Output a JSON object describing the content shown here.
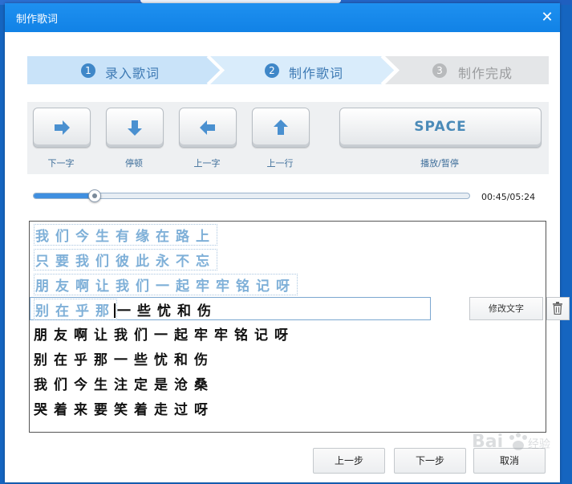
{
  "dialog": {
    "title": "制作歌词",
    "close_icon": "close-icon"
  },
  "steps": [
    {
      "num": "1",
      "label": "录入歌词",
      "state": "done"
    },
    {
      "num": "2",
      "label": "制作歌词",
      "state": "active"
    },
    {
      "num": "3",
      "label": "制作完成",
      "state": "pending"
    }
  ],
  "toolbar": {
    "next_word": {
      "icon": "arrow-right-icon",
      "label": "下一字"
    },
    "pause": {
      "icon": "arrow-down-icon",
      "label": "停顿"
    },
    "prev_word": {
      "icon": "arrow-left-icon",
      "label": "上一字"
    },
    "prev_line": {
      "icon": "arrow-up-icon",
      "label": "上一行"
    },
    "space": {
      "key": "SPACE",
      "label": "播放/暂停"
    }
  },
  "player": {
    "time": "00:45/05:24",
    "progress": 0.139
  },
  "lyrics": {
    "done_lines": [
      "我们今生有缘在路上",
      "只要我们彼此永不忘",
      "朋友啊让我们一起牢牢铭记呀"
    ],
    "current": {
      "done_part": "别在乎那",
      "pending_part": "一些忧和伤"
    },
    "pending_lines": [
      "朋友啊让我们一起牢牢铭记呀",
      "别在乎那一些忧和伤",
      "我们今生注定是沧桑",
      "哭着来要笑着走过呀"
    ]
  },
  "edit": {
    "modify_label": "修改文字",
    "delete_icon": "trash-icon"
  },
  "footer": {
    "prev_step": "上一步",
    "next_step": "下一步",
    "cancel": "取消"
  },
  "watermark": {
    "text": "Bai 经验"
  },
  "colors": {
    "title_bar": "#1182e6",
    "step_active": "#c8e3f9",
    "done_text": "#7fb0d8",
    "progress": "#3f8fe0"
  }
}
